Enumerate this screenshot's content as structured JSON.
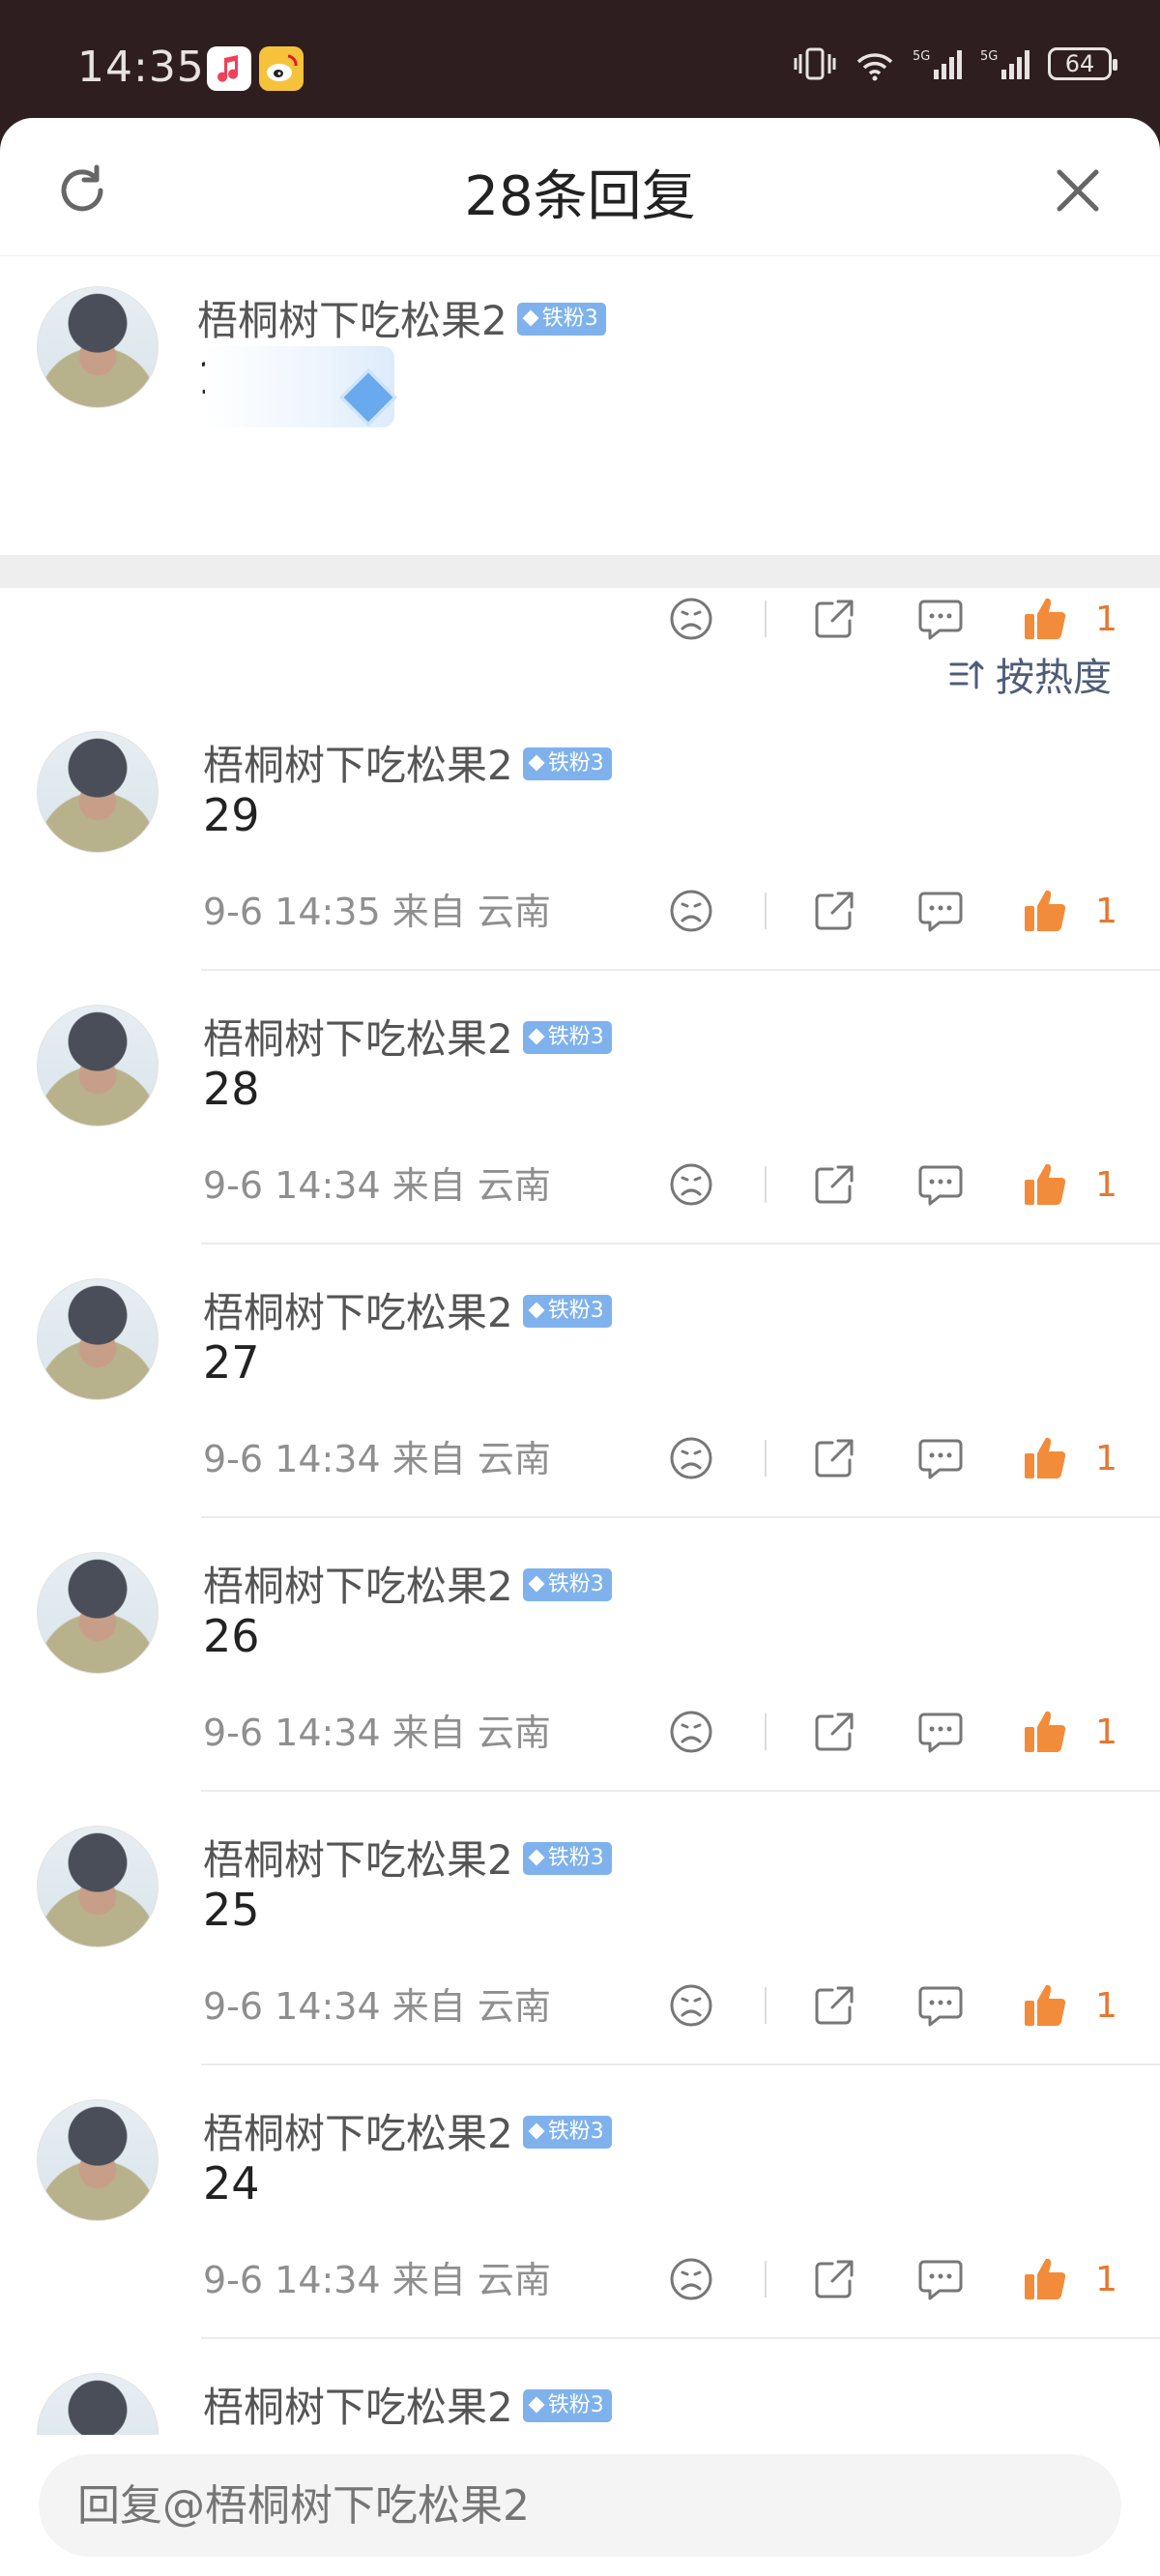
{
  "status_bar": {
    "time": "14:35",
    "apps": [
      "music-app-icon",
      "weibo-app-icon"
    ],
    "battery": "64",
    "network": [
      "vibrate-icon",
      "wifi-icon",
      "5g-signal-icon",
      "5g-signal-icon"
    ]
  },
  "header": {
    "title": "28条回复",
    "refresh_icon": "refresh-icon",
    "close_icon": "close-icon"
  },
  "original_comment": {
    "user": "梧桐树下吃松果2",
    "badge": "铁粉3",
    "text": "1",
    "like_count": "1"
  },
  "sort": {
    "label": "按热度",
    "icon": "sort-icon"
  },
  "replies": [
    {
      "user": "梧桐树下吃松果2",
      "badge": "铁粉3",
      "text": "29",
      "time": "9-6 14:35",
      "source": "来自 云南",
      "like_count": "1"
    },
    {
      "user": "梧桐树下吃松果2",
      "badge": "铁粉3",
      "text": "28",
      "time": "9-6 14:34",
      "source": "来自 云南",
      "like_count": "1"
    },
    {
      "user": "梧桐树下吃松果2",
      "badge": "铁粉3",
      "text": "27",
      "time": "9-6 14:34",
      "source": "来自 云南",
      "like_count": "1"
    },
    {
      "user": "梧桐树下吃松果2",
      "badge": "铁粉3",
      "text": "26",
      "time": "9-6 14:34",
      "source": "来自 云南",
      "like_count": "1"
    },
    {
      "user": "梧桐树下吃松果2",
      "badge": "铁粉3",
      "text": "25",
      "time": "9-6 14:34",
      "source": "来自 云南",
      "like_count": "1"
    },
    {
      "user": "梧桐树下吃松果2",
      "badge": "铁粉3",
      "text": "24",
      "time": "9-6 14:34",
      "source": "来自 云南",
      "like_count": "1"
    },
    {
      "user": "梧桐树下吃松果2",
      "badge": "铁粉3"
    }
  ],
  "reply_input": {
    "placeholder": "回复@梧桐树下吃松果2"
  },
  "colors": {
    "like": "#e8762e",
    "badge": "#7fb2ec",
    "sort": "#4e5c78",
    "status_bg": "#2e1e1f"
  }
}
